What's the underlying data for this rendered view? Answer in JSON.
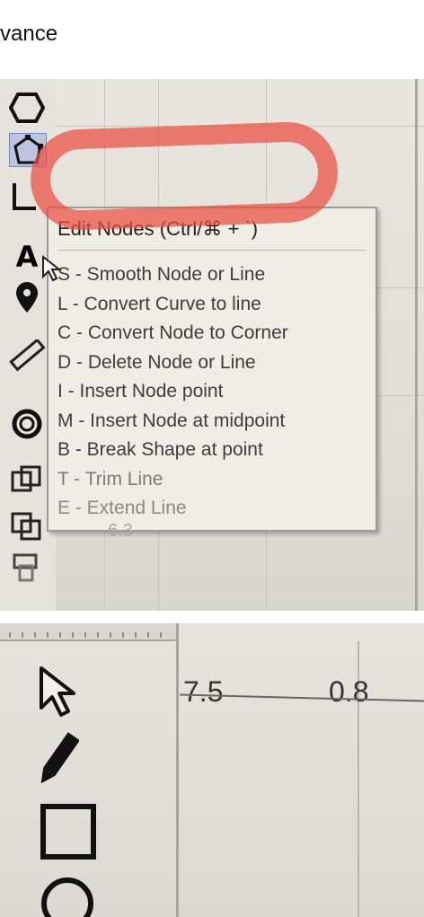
{
  "top_text": "vance",
  "popup": {
    "title": "Edit Nodes (Ctrl/⌘ + `)",
    "items": [
      "S - Smooth Node or Line",
      "L - Convert Curve to line",
      "C - Convert Node to Corner",
      "D - Delete Node or Line",
      "I - Insert Node point",
      "M - Insert Node at midpoint",
      "B - Break Shape at point",
      "T - Trim Line",
      "E - Extend Line"
    ]
  },
  "faint_value": "6.3",
  "values": {
    "v1": "7.5",
    "v2": "0.8"
  },
  "colors": {
    "highlight": "#ec4e40",
    "background": "#e9e6df"
  },
  "tools_left": [
    "hexagon-icon",
    "edit-nodes-icon",
    "line-tool-icon",
    "text-tool-icon",
    "pin-icon",
    "ruler-icon",
    "ring-icon",
    "weld-icon",
    "group-icon",
    "offset-icon"
  ],
  "tools_bottom": [
    "pointer-icon",
    "pencil-icon",
    "rectangle-icon",
    "circle-icon"
  ]
}
